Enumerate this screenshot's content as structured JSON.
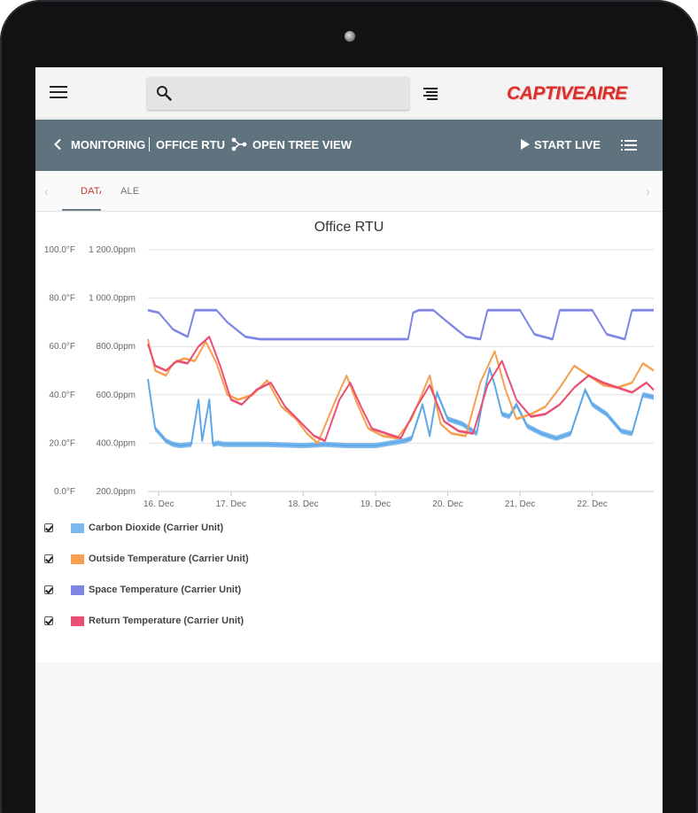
{
  "appbar": {
    "search": {
      "value": "",
      "placeholder": ""
    },
    "logo_text": "CAPTIVEAIRE"
  },
  "navbar": {
    "back_label": "MONITORING",
    "current_label": "OFFICE RTU",
    "tree_view_label": "OPEN TREE VIEW",
    "start_live_label": "START LIVE"
  },
  "tabs": [
    {
      "label": "DATA",
      "active": true
    },
    {
      "label": "ALERTS",
      "active": false
    }
  ],
  "colors": {
    "accent_tab": "#c0392b",
    "navbar": "#5f737e",
    "co2": "#5fa8e8",
    "outside": "#f5a04e",
    "space": "#7f85e5",
    "return": "#ea4f73"
  },
  "chart_data": {
    "type": "area",
    "title": "Office RTU",
    "x_ticks": [
      "16. Dec",
      "17. Dec",
      "18. Dec",
      "19. Dec",
      "20. Dec",
      "21. Dec",
      "22. Dec"
    ],
    "x_range_days": [
      15.85,
      22.85
    ],
    "y_left": {
      "ticks": [
        "0.0°F",
        "20.0°F",
        "40.0°F",
        "60.0°F",
        "80.0°F",
        "100.0°F"
      ],
      "range": [
        0,
        100
      ]
    },
    "y_right": {
      "ticks": [
        "200.0ppm",
        "400.0ppm",
        "600.0ppm",
        "800.0ppm",
        "1 000.0ppm",
        "1 200.0ppm"
      ],
      "range": [
        200,
        1200
      ]
    },
    "grid": true,
    "legend_position": "bottom-left",
    "series": [
      {
        "name": "Carbon Dioxide (Carrier Unit)",
        "axis": "right",
        "color": "co2",
        "x": [
          15.85,
          15.95,
          16.1,
          16.2,
          16.3,
          16.45,
          16.55,
          16.6,
          16.7,
          16.75,
          16.82,
          16.9,
          17.0,
          17.5,
          18.0,
          18.3,
          18.6,
          19.0,
          19.4,
          19.5,
          19.65,
          19.75,
          19.85,
          20.0,
          20.2,
          20.4,
          20.5,
          20.58,
          20.65,
          20.75,
          20.85,
          20.95,
          21.1,
          21.3,
          21.5,
          21.7,
          21.9,
          22.0,
          22.2,
          22.4,
          22.55,
          22.7,
          22.85
        ],
        "values": [
          665,
          460,
          410,
          395,
          390,
          395,
          580,
          410,
          580,
          395,
          400,
          395,
          395,
          395,
          390,
          395,
          390,
          390,
          410,
          420,
          560,
          430,
          610,
          500,
          480,
          440,
          600,
          710,
          640,
          520,
          510,
          560,
          470,
          440,
          420,
          440,
          620,
          560,
          520,
          450,
          440,
          600,
          590
        ]
      },
      {
        "name": "Outside Temperature (Carrier Unit)",
        "axis": "left",
        "color": "outside",
        "x": [
          15.85,
          15.95,
          16.1,
          16.2,
          16.35,
          16.5,
          16.65,
          16.8,
          16.95,
          17.1,
          17.3,
          17.5,
          17.7,
          17.9,
          18.05,
          18.2,
          18.45,
          18.6,
          18.75,
          18.9,
          19.1,
          19.3,
          19.5,
          19.75,
          19.9,
          20.05,
          20.25,
          20.45,
          20.65,
          20.8,
          20.95,
          21.15,
          21.35,
          21.55,
          21.75,
          21.95,
          22.15,
          22.35,
          22.55,
          22.7,
          22.85
        ],
        "values": [
          63,
          50,
          48,
          53,
          55,
          54,
          62,
          53,
          40,
          38,
          40,
          46,
          35,
          30,
          24,
          20,
          38,
          48,
          36,
          26,
          23,
          22,
          30,
          48,
          28,
          24,
          23,
          45,
          58,
          42,
          30,
          32,
          35,
          43,
          52,
          48,
          44,
          43,
          45,
          53,
          50
        ]
      },
      {
        "name": "Space Temperature (Carrier Unit)",
        "axis": "left",
        "color": "space",
        "x": [
          15.85,
          16.0,
          16.2,
          16.4,
          16.5,
          16.8,
          16.95,
          17.2,
          17.4,
          17.55,
          17.7,
          18.0,
          18.5,
          18.65,
          19.0,
          19.45,
          19.52,
          19.6,
          19.8,
          20.0,
          20.25,
          20.45,
          20.55,
          20.85,
          21.0,
          21.2,
          21.45,
          21.55,
          21.8,
          22.0,
          22.2,
          22.45,
          22.55,
          22.85
        ],
        "values": [
          75,
          74,
          67,
          64,
          75,
          75,
          70,
          64,
          63,
          63,
          63,
          63,
          63,
          63,
          63,
          63,
          74,
          75,
          75,
          70,
          64,
          63,
          75,
          75,
          75,
          65,
          63,
          75,
          75,
          75,
          65,
          63,
          75,
          75
        ]
      },
      {
        "name": "Return Temperature (Carrier Unit)",
        "axis": "left",
        "color": "return",
        "x": [
          15.85,
          15.95,
          16.1,
          16.25,
          16.4,
          16.55,
          16.7,
          16.85,
          17.0,
          17.15,
          17.35,
          17.55,
          17.75,
          17.95,
          18.15,
          18.3,
          18.5,
          18.65,
          18.8,
          18.95,
          19.15,
          19.35,
          19.55,
          19.75,
          19.95,
          20.15,
          20.35,
          20.55,
          20.75,
          20.95,
          21.15,
          21.35,
          21.55,
          21.75,
          21.95,
          22.15,
          22.35,
          22.55,
          22.75,
          22.85
        ],
        "values": [
          61,
          52,
          50,
          54,
          53,
          60,
          64,
          52,
          38,
          36,
          42,
          45,
          35,
          29,
          23,
          21,
          38,
          45,
          35,
          26,
          24,
          22,
          34,
          44,
          29,
          25,
          24,
          44,
          54,
          38,
          31,
          32,
          36,
          43,
          48,
          45,
          43,
          41,
          45,
          42
        ]
      }
    ]
  },
  "legend": [
    {
      "label": "Carbon Dioxide (Carrier Unit)",
      "color": "#7db8ec",
      "checked": true
    },
    {
      "label": "Outside Temperature (Carrier Unit)",
      "color": "#f5a04e",
      "checked": true
    },
    {
      "label": "Space Temperature (Carrier Unit)",
      "color": "#7f85e5",
      "checked": true
    },
    {
      "label": "Return Temperature (Carrier Unit)",
      "color": "#ea4f73",
      "checked": true
    }
  ]
}
